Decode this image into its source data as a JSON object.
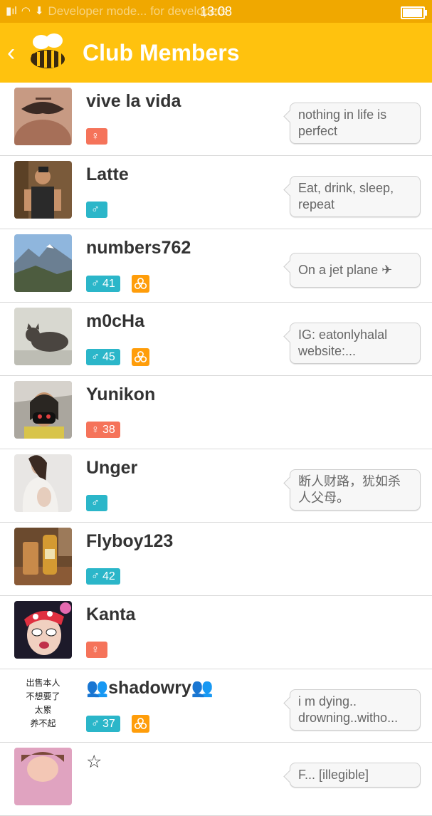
{
  "status_bar": {
    "notification_text": "Developer mode... for developers",
    "time": "13:08",
    "battery_percent": 90
  },
  "header": {
    "back_icon": "chevron-left-icon",
    "logo_icon": "bee-logo-icon",
    "title": "Club Members"
  },
  "colors": {
    "app_bar": "#ffc20e",
    "status_bar": "#f0a800",
    "male_badge": "#2bb6c9",
    "female_badge": "#f5735a",
    "hive_badge": "#ff9d0a"
  },
  "members": [
    {
      "name": "vive la vida",
      "gender_symbol": "♀",
      "gender": "female",
      "age": "",
      "hive": false,
      "status": "nothing in life is perfect"
    },
    {
      "name": "Latte",
      "gender_symbol": "♂",
      "gender": "male",
      "age": "",
      "hive": false,
      "status": "Eat, drink, sleep, repeat"
    },
    {
      "name": "numbers762",
      "gender_symbol": "♂",
      "gender": "male",
      "age": "41",
      "hive": true,
      "status": "On a jet plane ✈"
    },
    {
      "name": "m0cHa",
      "gender_symbol": "♂",
      "gender": "male",
      "age": "45",
      "hive": true,
      "status": "IG: eatonlyhalal website:..."
    },
    {
      "name": "Yunikon",
      "gender_symbol": "♀",
      "gender": "female",
      "age": "38",
      "hive": false,
      "status": ""
    },
    {
      "name": "Unger",
      "gender_symbol": "♂",
      "gender": "male",
      "age": "",
      "hive": false,
      "status": "断人财路，犹如杀人父母。"
    },
    {
      "name": "Flyboy123",
      "gender_symbol": "♂",
      "gender": "male",
      "age": "42",
      "hive": false,
      "status": ""
    },
    {
      "name": "Kanta",
      "gender_symbol": "♀",
      "gender": "female",
      "age": "",
      "hive": false,
      "status": ""
    },
    {
      "name": "👥shadowry👥",
      "gender_symbol": "♂",
      "gender": "male",
      "age": "37",
      "hive": true,
      "status": "i m dying.. drowning..witho..."
    },
    {
      "name": "☆",
      "gender_symbol": "",
      "gender": "",
      "age": "",
      "hive": false,
      "status": "F... [illegible]"
    }
  ],
  "avatar_8_text": [
    "出售本人",
    "不想要了",
    "太累",
    "养不起"
  ]
}
